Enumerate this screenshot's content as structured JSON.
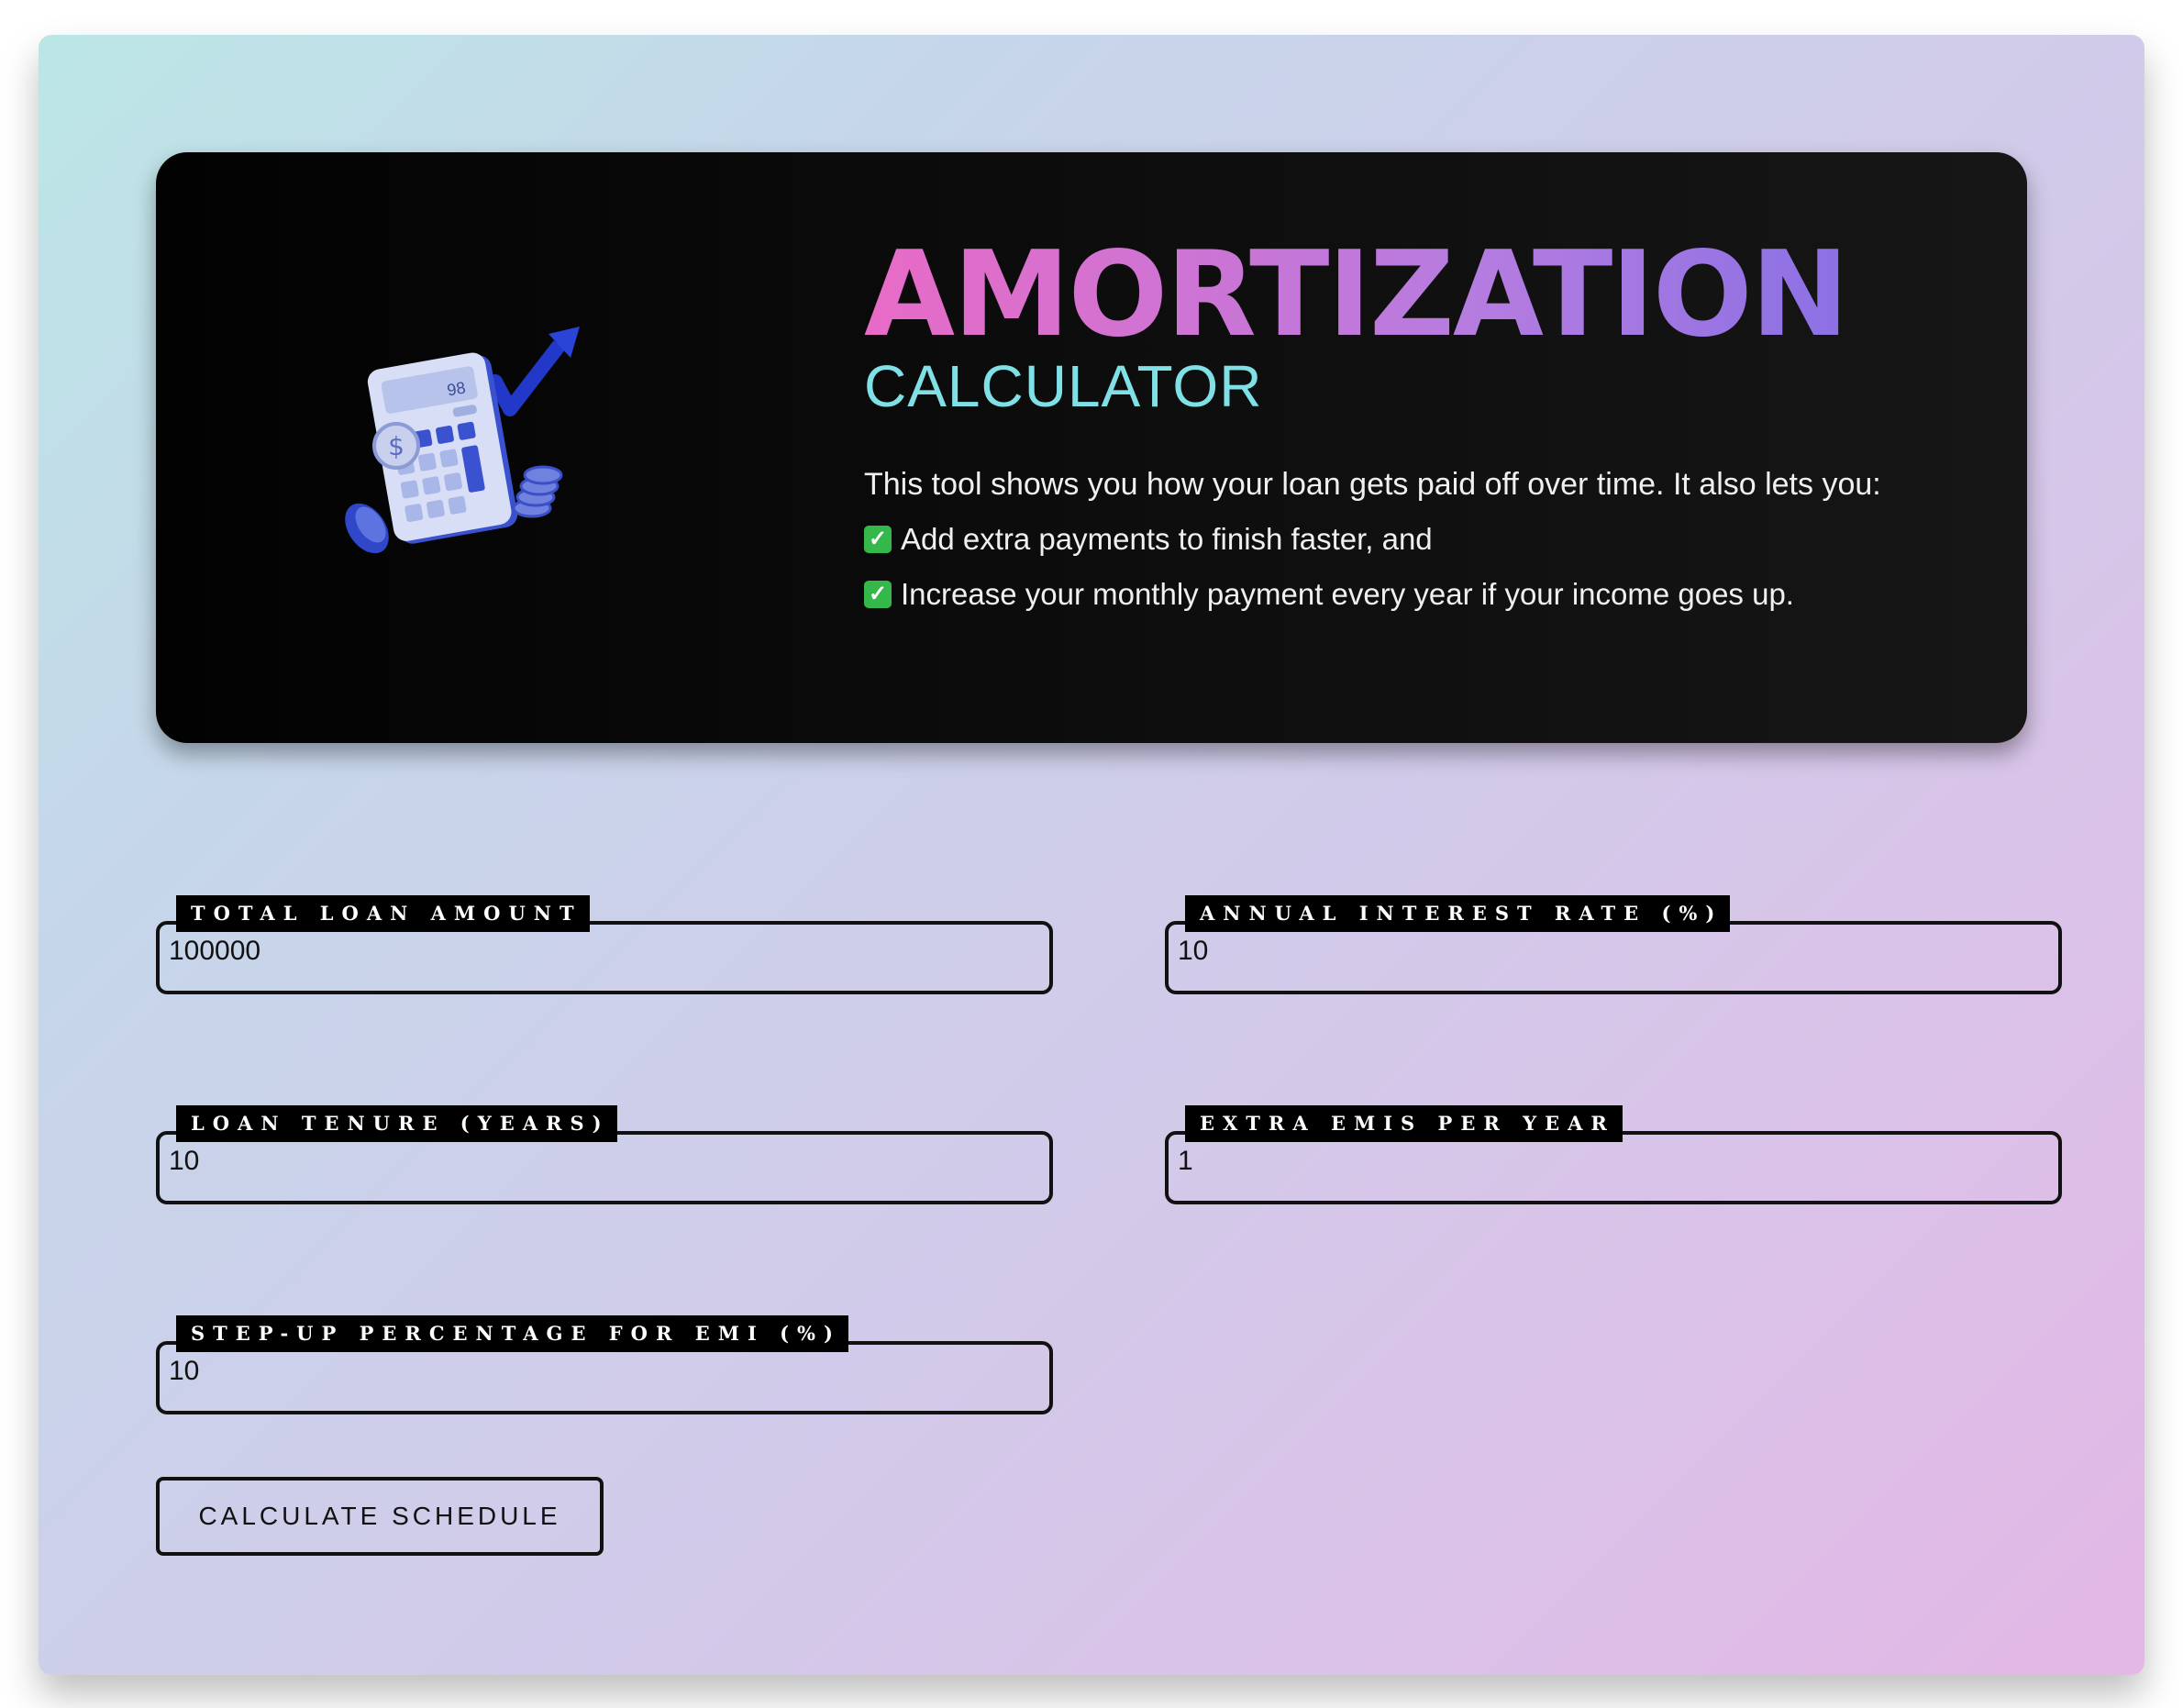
{
  "hero": {
    "title": "AMORTIZATION",
    "subtitle": "CALCULATOR",
    "description": "This tool shows you how your loan gets paid off over time. It also lets you:",
    "bullets": [
      "Add extra payments to finish faster, and",
      "Increase your monthly payment every year if your income goes up."
    ],
    "bullet_icon": "check-mark-icon",
    "illustration_icon": "calculator-growth-icon",
    "calculator_display": "98",
    "colors": {
      "title_gradient_start": "#e86bc6",
      "title_gradient_end": "#7c6ce6",
      "subtitle": "#7fe0e6",
      "check": "#34b84a"
    }
  },
  "form": {
    "loan_amount": {
      "label": "TOTAL LOAN AMOUNT",
      "value": "100000"
    },
    "interest_rate": {
      "label": "ANNUAL INTEREST RATE (%)",
      "value": "10"
    },
    "tenure": {
      "label": "LOAN TENURE (YEARS)",
      "value": "10"
    },
    "extra_emis": {
      "label": "EXTRA EMIS PER YEAR",
      "value": "1"
    },
    "step_up": {
      "label": "STEP-UP PERCENTAGE FOR EMI (%)",
      "value": "10"
    }
  },
  "actions": {
    "calculate_label": "CALCULATE SCHEDULE"
  }
}
